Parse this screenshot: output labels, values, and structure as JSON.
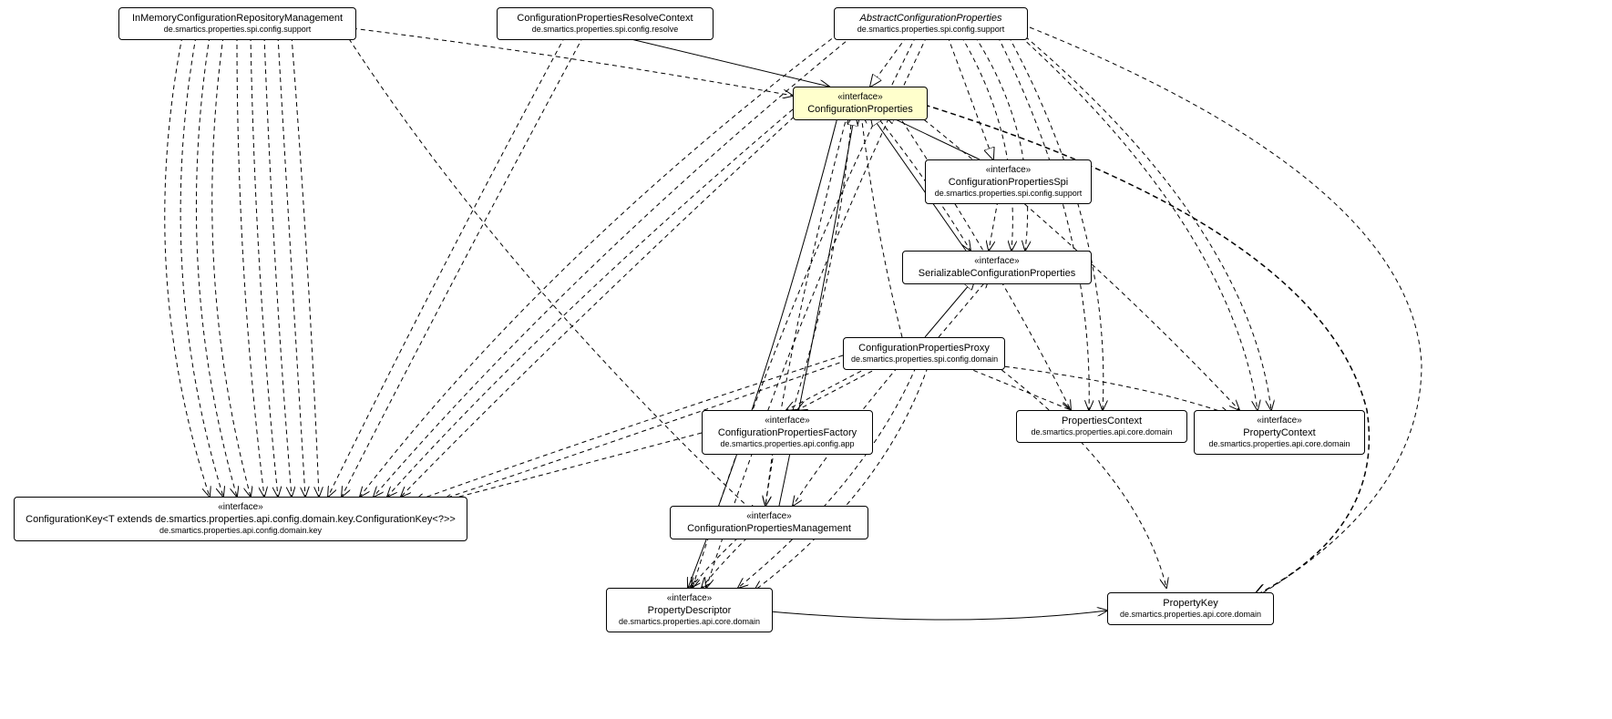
{
  "nodes": {
    "inMemory": {
      "name": "InMemoryConfigurationRepositoryManagement",
      "package": "de.smartics.properties.spi.config.support"
    },
    "resolveContext": {
      "name": "ConfigurationPropertiesResolveContext",
      "package": "de.smartics.properties.spi.config.resolve"
    },
    "abstractConfig": {
      "name": "AbstractConfigurationProperties",
      "package": "de.smartics.properties.spi.config.support"
    },
    "configProperties": {
      "stereotype": "«interface»",
      "name": "ConfigurationProperties"
    },
    "configSpi": {
      "stereotype": "«interface»",
      "name": "ConfigurationPropertiesSpi",
      "package": "de.smartics.properties.spi.config.support"
    },
    "serializable": {
      "stereotype": "«interface»",
      "name": "SerializableConfigurationProperties"
    },
    "proxy": {
      "name": "ConfigurationPropertiesProxy",
      "package": "de.smartics.properties.spi.config.domain"
    },
    "factory": {
      "stereotype": "«interface»",
      "name": "ConfigurationPropertiesFactory",
      "package": "de.smartics.properties.api.config.app"
    },
    "propertiesContext": {
      "name": "PropertiesContext",
      "package": "de.smartics.properties.api.core.domain"
    },
    "propertyContext": {
      "stereotype": "«interface»",
      "name": "PropertyContext",
      "package": "de.smartics.properties.api.core.domain"
    },
    "configKey": {
      "stereotype": "«interface»",
      "name": "ConfigurationKey<T extends de.smartics.properties.api.config.domain.key.ConfigurationKey<?>>",
      "package": "de.smartics.properties.api.config.domain.key"
    },
    "management": {
      "stereotype": "«interface»",
      "name": "ConfigurationPropertiesManagement"
    },
    "propertyDescriptor": {
      "stereotype": "«interface»",
      "name": "PropertyDescriptor",
      "package": "de.smartics.properties.api.core.domain"
    },
    "propertyKey": {
      "name": "PropertyKey",
      "package": "de.smartics.properties.api.core.domain"
    }
  }
}
